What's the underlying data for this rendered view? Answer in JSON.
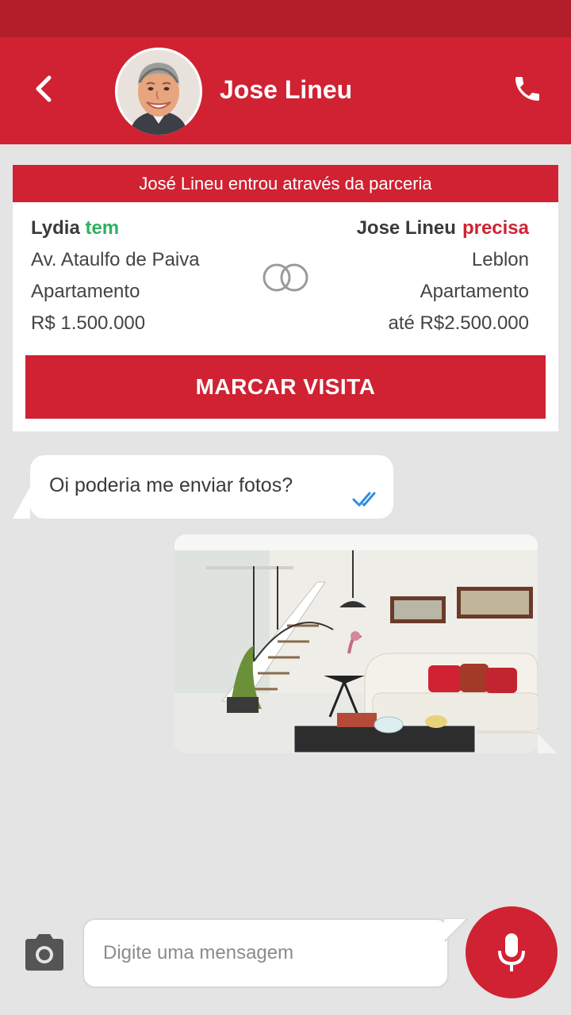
{
  "header": {
    "contact_name": "Jose Lineu",
    "back_icon": "chevron-left-icon",
    "call_icon": "phone-icon"
  },
  "match_card": {
    "banner": "José Lineu entrou através da parceria",
    "left": {
      "name": "Lydia",
      "tag": "tem",
      "address": "Av. Ataulfo de Paiva",
      "type": "Apartamento",
      "price": "R$ 1.500.000"
    },
    "right": {
      "name": "Jose Lineu",
      "tag": "precisa",
      "neighborhood": "Leblon",
      "type": "Apartamento",
      "price": "até R$2.500.000"
    },
    "button": "MARCAR VISITA"
  },
  "messages": [
    {
      "direction": "incoming",
      "text": "Oi poderia me enviar fotos?",
      "status": "read"
    },
    {
      "direction": "outgoing",
      "type": "photo",
      "content": "living-room-photo"
    }
  ],
  "composer": {
    "placeholder": "Digite uma mensagem",
    "camera_icon": "camera-icon",
    "mic_icon": "microphone-icon"
  },
  "colors": {
    "brand_red": "#d02232",
    "status_bar": "#b21f2b",
    "has_green": "#2eb15f",
    "read_check": "#2f8ee0",
    "background": "#e4e4e4"
  }
}
